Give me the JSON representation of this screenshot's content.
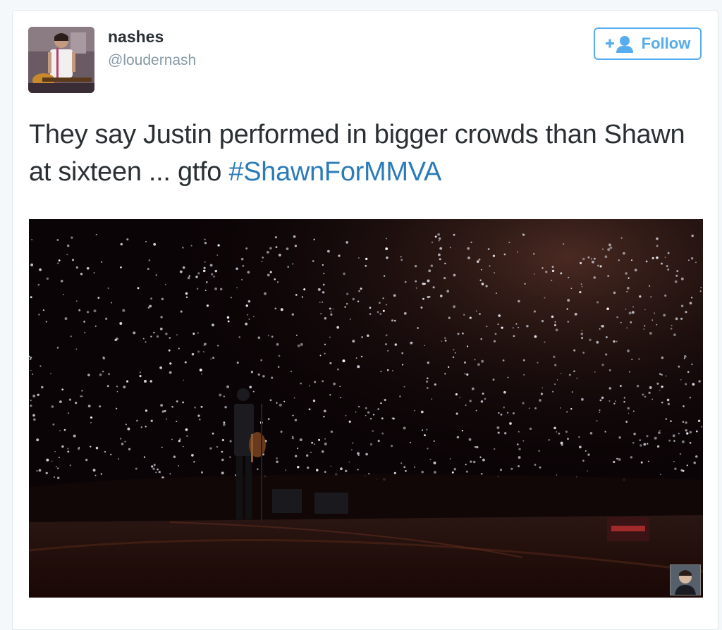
{
  "tweet": {
    "author": {
      "display_name": "nashes",
      "screen_name": "@loudernash",
      "avatar_icon": "avatar-guitarist-photo"
    },
    "follow_button": {
      "label": "Follow",
      "icon": "add-user-icon"
    },
    "text": "They say Justin performed in bigger crowds than Shawn at sixteen ... gtfo ",
    "hashtag": "#ShawnForMMVA",
    "media": {
      "kind": "photo",
      "thumbnail_icon": "person-thumbnail"
    }
  },
  "colors": {
    "accent": "#55acee",
    "hashtag": "#2b7bb9",
    "text": "#292f33",
    "secondary_text": "#8899a6",
    "border": "#e1e8ed"
  }
}
